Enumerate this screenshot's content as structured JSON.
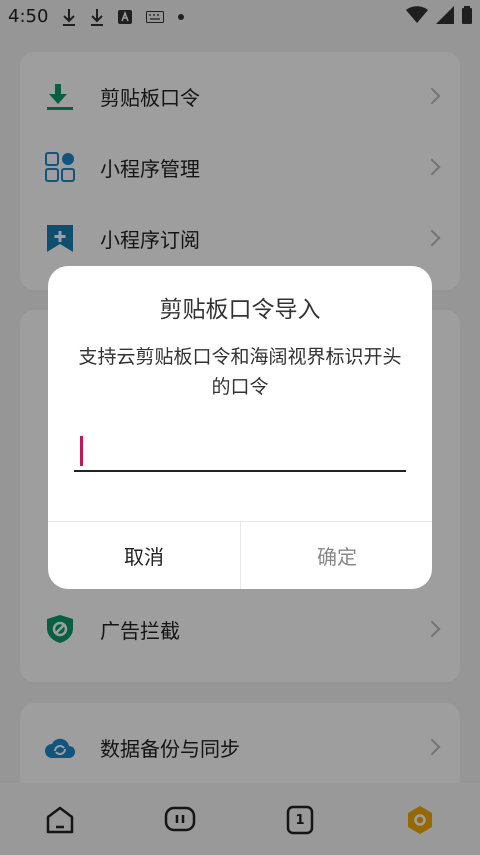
{
  "status_bar": {
    "time": "4:50"
  },
  "menu": {
    "group1": [
      {
        "label": "剪贴板口令",
        "icon": "download-arrow-icon"
      },
      {
        "label": "小程序管理",
        "icon": "apps-grid-icon"
      },
      {
        "label": "小程序订阅",
        "icon": "bookmark-plus-icon"
      }
    ],
    "group2": [
      {
        "label": "广告拦截",
        "icon": "shield-block-icon"
      }
    ],
    "group3": [
      {
        "label": "数据备份与同步",
        "icon": "cloud-sync-icon"
      }
    ]
  },
  "dialog": {
    "title": "剪贴板口令导入",
    "message": "支持云剪贴板口令和海阔视界标识开头的口令",
    "input_value": "",
    "cancel_label": "取消",
    "ok_label": "确定"
  },
  "bottom_nav": [
    {
      "icon": "home-icon"
    },
    {
      "icon": "chat-bubble-icon"
    },
    {
      "icon": "tabs-counter-icon",
      "count": "1"
    },
    {
      "icon": "settings-hexagon-icon"
    }
  ],
  "colors": {
    "accent_green": "#0a9a6a",
    "accent_blue": "#1e88c8",
    "caret": "#c2185b",
    "disabled_text": "#888888"
  }
}
